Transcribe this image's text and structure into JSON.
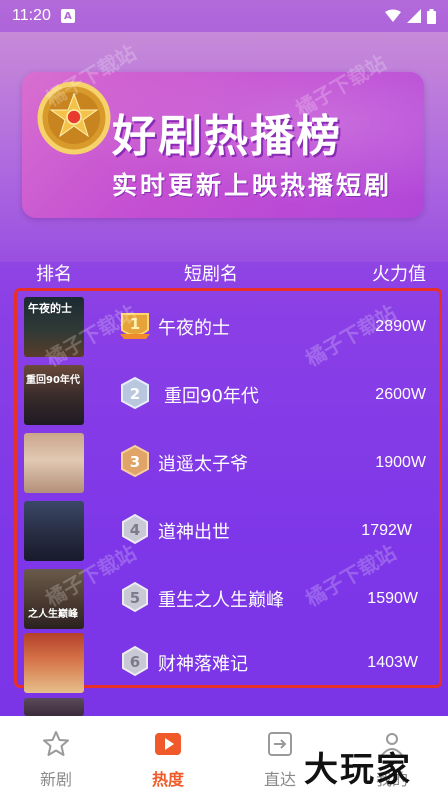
{
  "status": {
    "time": "11:20"
  },
  "banner": {
    "title": "好剧热播榜",
    "subtitle": "实时更新上映热播短剧"
  },
  "columns": {
    "rank": "排名",
    "name": "短剧名",
    "heat": "火力值"
  },
  "rows": [
    {
      "rank": "1",
      "title": "午夜的士",
      "heat": "2890W",
      "poster_text": "午夜的士"
    },
    {
      "rank": "2",
      "title": "重回90年代",
      "heat": "2600W",
      "poster_text": "重回90年代"
    },
    {
      "rank": "3",
      "title": "逍遥太子爷",
      "heat": "1900W",
      "poster_text": ""
    },
    {
      "rank": "4",
      "title": "道神出世",
      "heat": "1792W",
      "poster_text": ""
    },
    {
      "rank": "5",
      "title": "重生之人生巅峰",
      "heat": "1590W",
      "poster_text": "之人生巅峰"
    },
    {
      "rank": "6",
      "title": "财神落难记",
      "heat": "1403W",
      "poster_text": ""
    }
  ],
  "watermark": "橘子下载站",
  "nav": {
    "items": [
      {
        "label": "新剧",
        "icon": "star-icon"
      },
      {
        "label": "热度",
        "icon": "play-icon"
      },
      {
        "label": "直达",
        "icon": "enter-icon"
      },
      {
        "label": "我的",
        "icon": "person-icon"
      }
    ]
  },
  "brand": "大玩家",
  "colors": {
    "accent": "#f05a2a",
    "frame": "#e8302a",
    "bg": "#8a3fe6"
  }
}
